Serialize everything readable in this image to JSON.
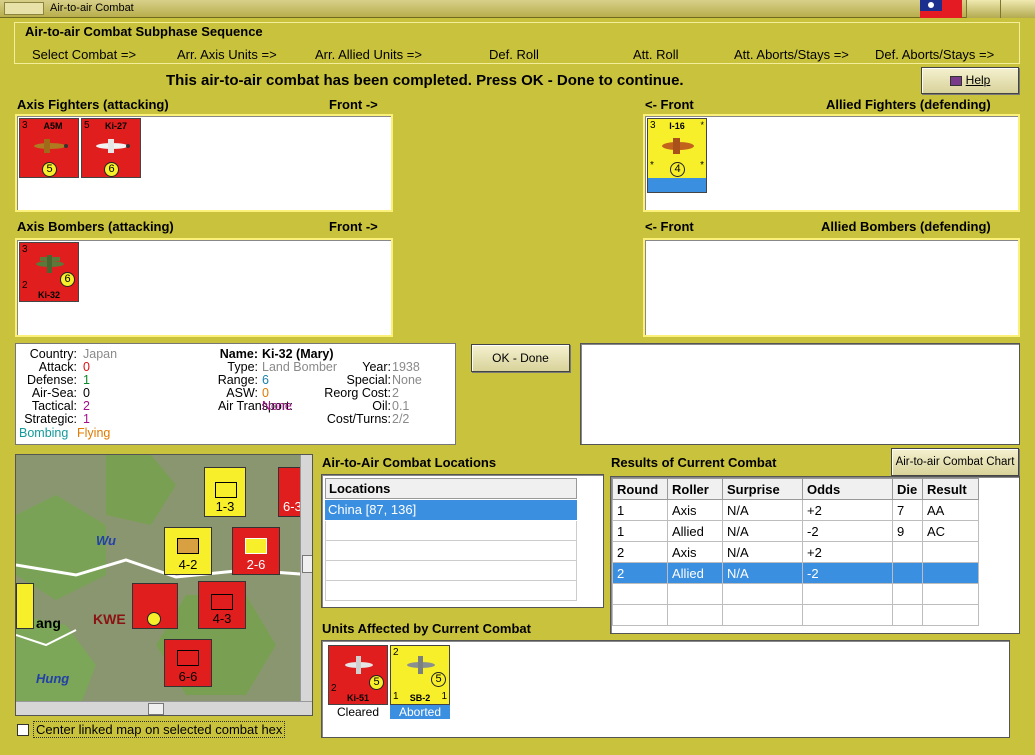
{
  "window": {
    "title": "Air-to-air Combat"
  },
  "sequence": {
    "title": "Air-to-air Combat Subphase Sequence",
    "steps": [
      "Select Combat =>",
      "Arr. Axis Units =>",
      "Arr. Allied Units =>",
      "Def. Roll",
      "Att. Roll",
      "Att. Aborts/Stays =>",
      "Def. Aborts/Stays =>"
    ]
  },
  "status_message": "This air-to-air combat has been completed.  Press OK - Done to continue.",
  "help_button": "Help",
  "axis_fighters": {
    "label": "Axis Fighters (attacking)",
    "front": "Front ->",
    "units": [
      {
        "name": "A5M",
        "top_left": "3",
        "bottom": "5"
      },
      {
        "name": "Ki-27",
        "top_left": "5",
        "bottom": "6"
      }
    ]
  },
  "allied_fighters": {
    "label": "Allied Fighters (defending)",
    "front": "<- Front",
    "units": [
      {
        "name": "I-16",
        "top_left": "3",
        "top_right": "*",
        "bottom": "4",
        "bl": "*",
        "br": "*"
      }
    ]
  },
  "axis_bombers": {
    "label": "Axis Bombers (attacking)",
    "front": "Front ->",
    "units": [
      {
        "name": "Ki-32",
        "top_left": "3",
        "mid": "6",
        "bl": "2"
      }
    ]
  },
  "allied_bombers": {
    "label": "Allied Bombers (defending)",
    "front": "<- Front"
  },
  "ok_button": "OK - Done",
  "unit_info": {
    "country_label": "Country:",
    "country": "Japan",
    "attack_label": "Attack:",
    "attack": "0",
    "defense_label": "Defense:",
    "defense": "1",
    "airsea_label": "Air-Sea:",
    "airsea": "0",
    "tactical_label": "Tactical:",
    "tactical": "2",
    "strategic_label": "Strategic:",
    "strategic": "1",
    "bombing": "Bombing",
    "flying": "Flying",
    "name_label": "Name:",
    "name": "Ki-32 (Mary)",
    "type_label": "Type:",
    "type": "Land Bomber",
    "year_label": "Year:",
    "year": "1938",
    "range_label": "Range:",
    "range": "6",
    "special_label": "Special:",
    "special": "None",
    "asw_label": "ASW:",
    "asw": "0",
    "reorg_label": "Reorg Cost:",
    "reorg": "2",
    "transport_label": "Air Transport:",
    "transport": "None",
    "oil_label": "Oil:",
    "oil": "0.1",
    "cost_label": "Cost/Turns:",
    "cost": "2/2"
  },
  "map": {
    "labels": [
      "Wu",
      "ang",
      "KWE",
      "Hung"
    ],
    "center_checkbox": "Center linked map on selected combat hex",
    "units": [
      "1-3",
      "4-2",
      "2-6",
      "4-3",
      "6-6",
      "6-3"
    ]
  },
  "locations": {
    "label": "Air-to-Air Combat Locations",
    "header": "Locations",
    "rows": [
      "China [87, 136]"
    ]
  },
  "results": {
    "label": "Results of Current Combat",
    "chart_button": "Air-to-air Combat Chart",
    "headers": [
      "Round",
      "Roller",
      "Surprise",
      "Odds",
      "Die",
      "Result"
    ],
    "rows": [
      [
        "1",
        "Axis",
        "N/A",
        "+2",
        "7",
        "AA"
      ],
      [
        "1",
        "Allied",
        "N/A",
        "-2",
        "9",
        "AC"
      ],
      [
        "2",
        "Axis",
        "N/A",
        "+2",
        "",
        ""
      ],
      [
        "2",
        "Allied",
        "N/A",
        "-2",
        "",
        ""
      ]
    ]
  },
  "affected": {
    "label": "Units Affected by Current Combat",
    "units": [
      {
        "name": "Ki-51",
        "status": "Cleared",
        "top_left": "",
        "mid": "5",
        "bl": "2"
      },
      {
        "name": "SB-2",
        "status": "Aborted",
        "top_left": "2",
        "mid": "5",
        "bl": "1",
        "br": "1"
      }
    ]
  }
}
